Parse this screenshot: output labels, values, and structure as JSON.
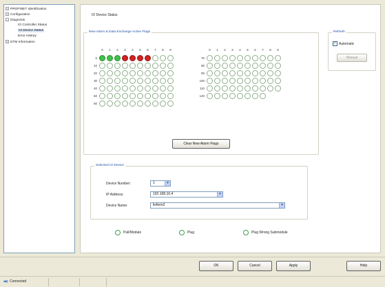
{
  "tree": {
    "items": [
      {
        "label": "PROFINET Identification",
        "expander": "+"
      },
      {
        "label": "Configuration",
        "expander": "+"
      },
      {
        "label": "Diagnosis",
        "expander": "-"
      },
      {
        "label": "IO Controller Status",
        "expander": ""
      },
      {
        "label": "IO Device Status",
        "expander": ""
      },
      {
        "label": "Error History",
        "expander": ""
      },
      {
        "label": "DTM Information",
        "expander": "+"
      }
    ]
  },
  "panel": {
    "title": "IO Device Status",
    "flags_group_label": "New Alarm & Data Exchange Active Flags",
    "clear_button": "Clear New Alarm Flags",
    "refresh": {
      "group_label": "Refresh",
      "automatic_label": "Automatic",
      "automatic_checked": true,
      "manual_button": "Manual",
      "manual_enabled": false
    },
    "selected_device": {
      "group_label": "Selected IO Device",
      "device_number_label": "Device Number:",
      "device_number_value": "1",
      "ip_label": "IP Address:",
      "ip_value": "192.168.10.4",
      "name_label": "Device Name:",
      "name_value": "lioferio2"
    },
    "radios": [
      "Pull/Module",
      "Plug",
      "Plug Wrong Submodule"
    ]
  },
  "grid": {
    "col_headers": [
      "0",
      "1",
      "2",
      "3",
      "4",
      "5",
      "6",
      "7",
      "8",
      "9"
    ],
    "left_rows": [
      "0",
      "10",
      "20",
      "30",
      "40",
      "50",
      "60"
    ],
    "right_rows": [
      "70",
      "80",
      "90",
      "100",
      "110",
      "120"
    ],
    "right_last_row_count": 8,
    "row0_states": [
      "green",
      "green",
      "green",
      "red",
      "red",
      "red",
      "red",
      "off",
      "off",
      "off"
    ]
  },
  "buttons": {
    "ok": "OK",
    "cancel": "Cancel",
    "apply": "Apply",
    "help": "Help"
  },
  "status": {
    "text": "Connected",
    "icon": "connected-plug-icon"
  },
  "colors": {
    "active_green": "#3ec34a",
    "alarm_red": "#d42222",
    "inactive_border": "#8cae88"
  }
}
